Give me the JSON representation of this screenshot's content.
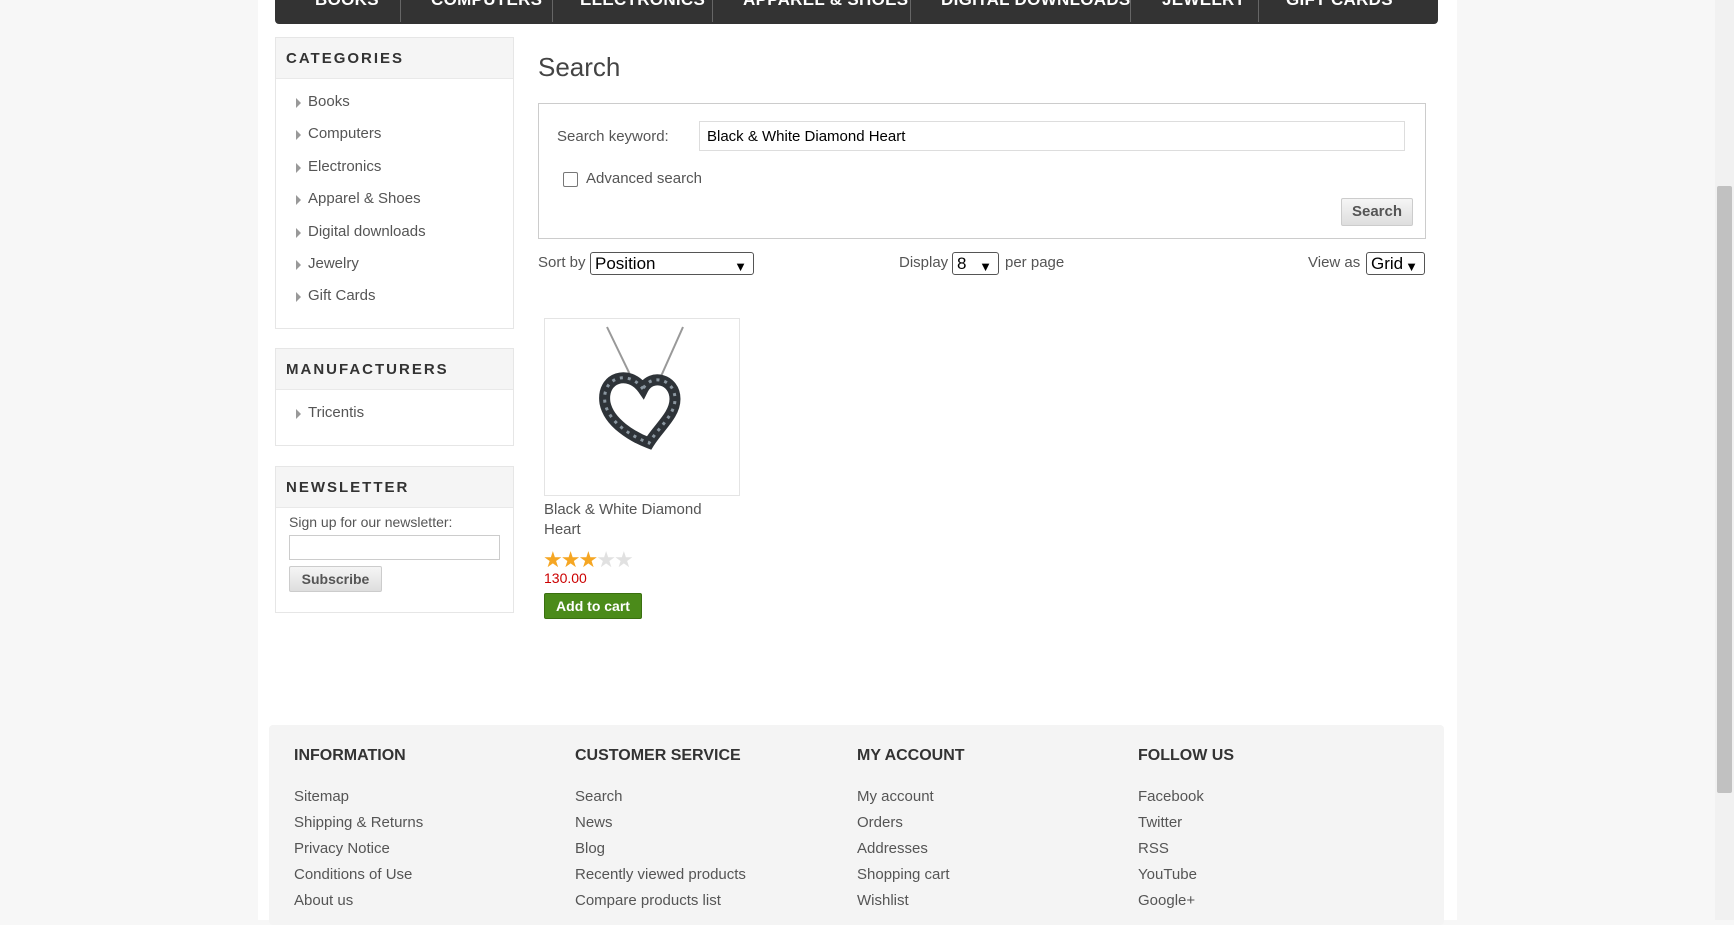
{
  "topmenu": {
    "items": [
      "BOOKS",
      "COMPUTERS",
      "ELECTRONICS",
      "APPAREL & SHOES",
      "DIGITAL DOWNLOADS",
      "JEWELRY",
      "GIFT CARDS"
    ]
  },
  "categories": {
    "title": "CATEGORIES",
    "items": [
      "Books",
      "Computers",
      "Electronics",
      "Apparel & Shoes",
      "Digital downloads",
      "Jewelry",
      "Gift Cards"
    ]
  },
  "manufacturers": {
    "title": "MANUFACTURERS",
    "items": [
      "Tricentis"
    ]
  },
  "newsletter": {
    "title": "NEWSLETTER",
    "label": "Sign up for our newsletter:",
    "button": "Subscribe"
  },
  "search": {
    "heading": "Search",
    "keyword_label": "Search keyword:",
    "keyword_value": "Black & White Diamond Heart",
    "advanced_label": "Advanced search",
    "button": "Search"
  },
  "controls": {
    "sort_label": "Sort by",
    "sort_value": "Position",
    "display_label": "Display",
    "display_value": "8",
    "per_page": "per page",
    "view_label": "View as",
    "view_value": "Grid"
  },
  "product": {
    "title": "Black & White Diamond Heart",
    "rating": 3,
    "rating_max": 5,
    "price": "130.00",
    "add_to_cart": "Add to cart"
  },
  "footer": {
    "columns": [
      {
        "title": "INFORMATION",
        "links": [
          "Sitemap",
          "Shipping & Returns",
          "Privacy Notice",
          "Conditions of Use",
          "About us"
        ]
      },
      {
        "title": "CUSTOMER SERVICE",
        "links": [
          "Search",
          "News",
          "Blog",
          "Recently viewed products",
          "Compare products list"
        ]
      },
      {
        "title": "MY ACCOUNT",
        "links": [
          "My account",
          "Orders",
          "Addresses",
          "Shopping cart",
          "Wishlist"
        ]
      },
      {
        "title": "FOLLOW US",
        "links": [
          "Facebook",
          "Twitter",
          "RSS",
          "YouTube",
          "Google+"
        ]
      }
    ]
  },
  "colors": {
    "menu_bg": "#333333",
    "add_to_cart": "#4b8b1a",
    "price": "#cc0000",
    "star": "#f5a623"
  }
}
